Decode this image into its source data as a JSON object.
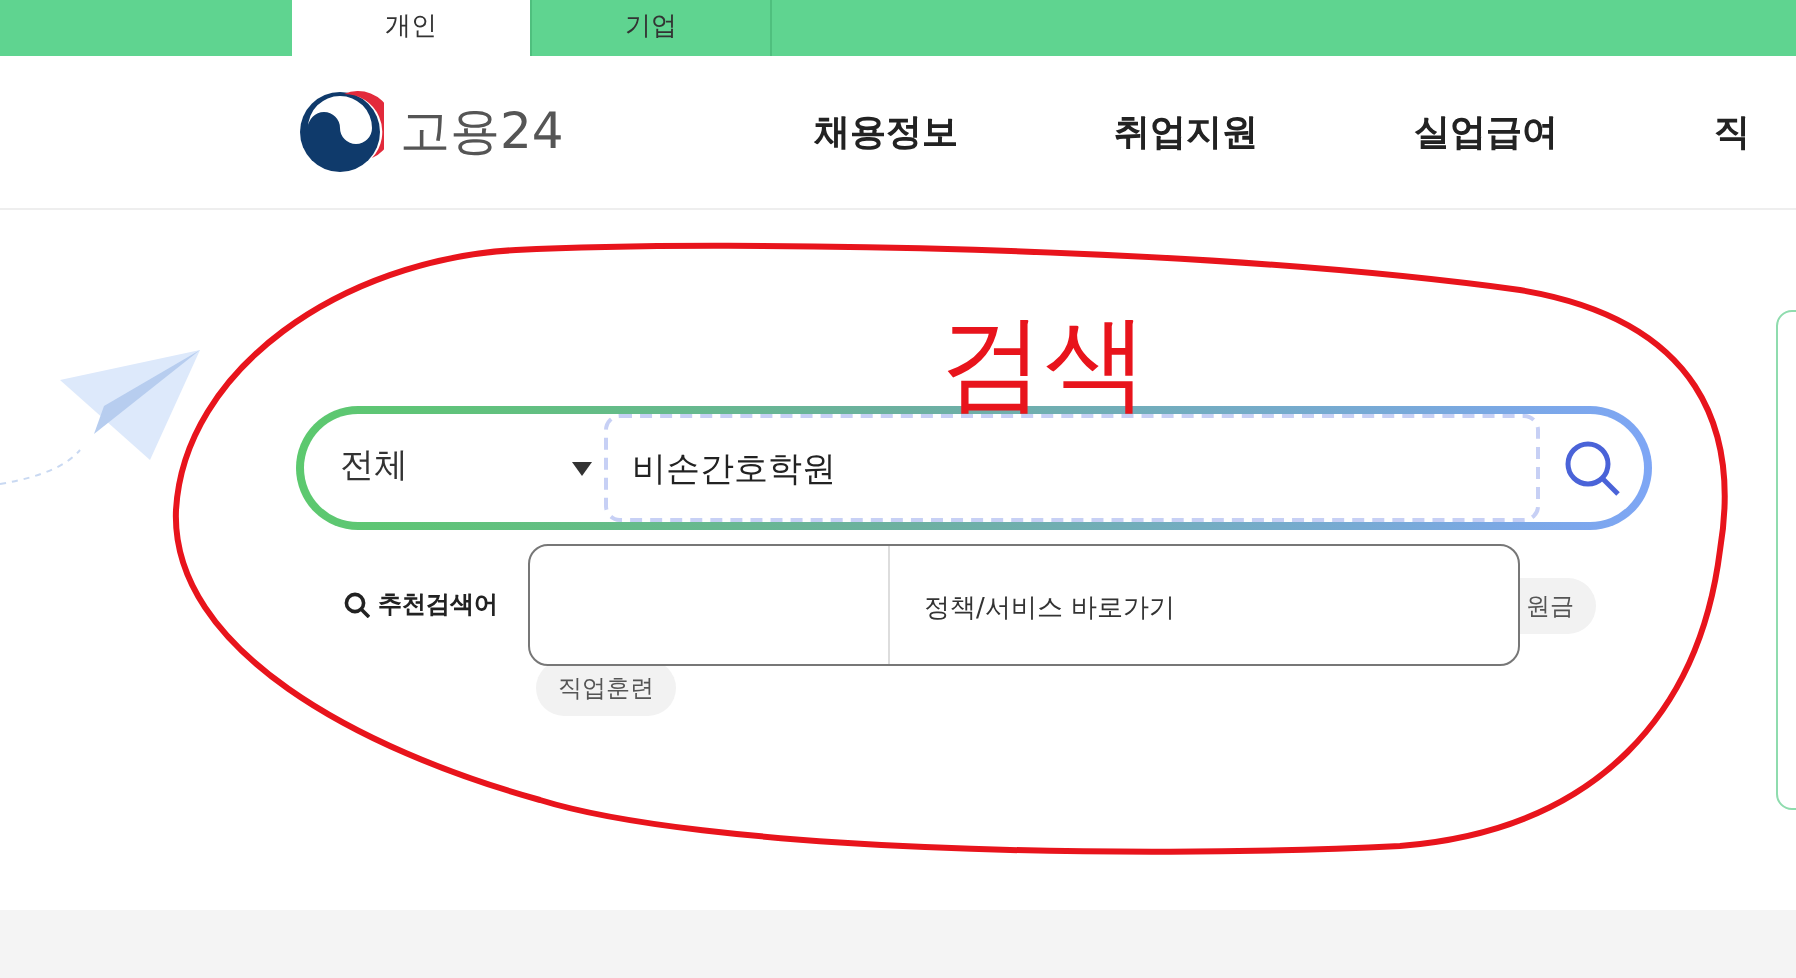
{
  "top_tabs": [
    {
      "label": "개인",
      "selected": true
    },
    {
      "label": "기업",
      "selected": false
    }
  ],
  "logo": {
    "text": "고용24"
  },
  "nav": [
    "채용정보",
    "취업지원",
    "실업급여",
    "직"
  ],
  "search": {
    "category": "전체",
    "query": "비손간호학원"
  },
  "recommended": {
    "label": "추천검색어",
    "keywords": [
      "원금",
      "직업훈련"
    ]
  },
  "dropdown": {
    "column_2": "정책/서비스 바로가기"
  },
  "annotation": {
    "text": "검색"
  }
}
